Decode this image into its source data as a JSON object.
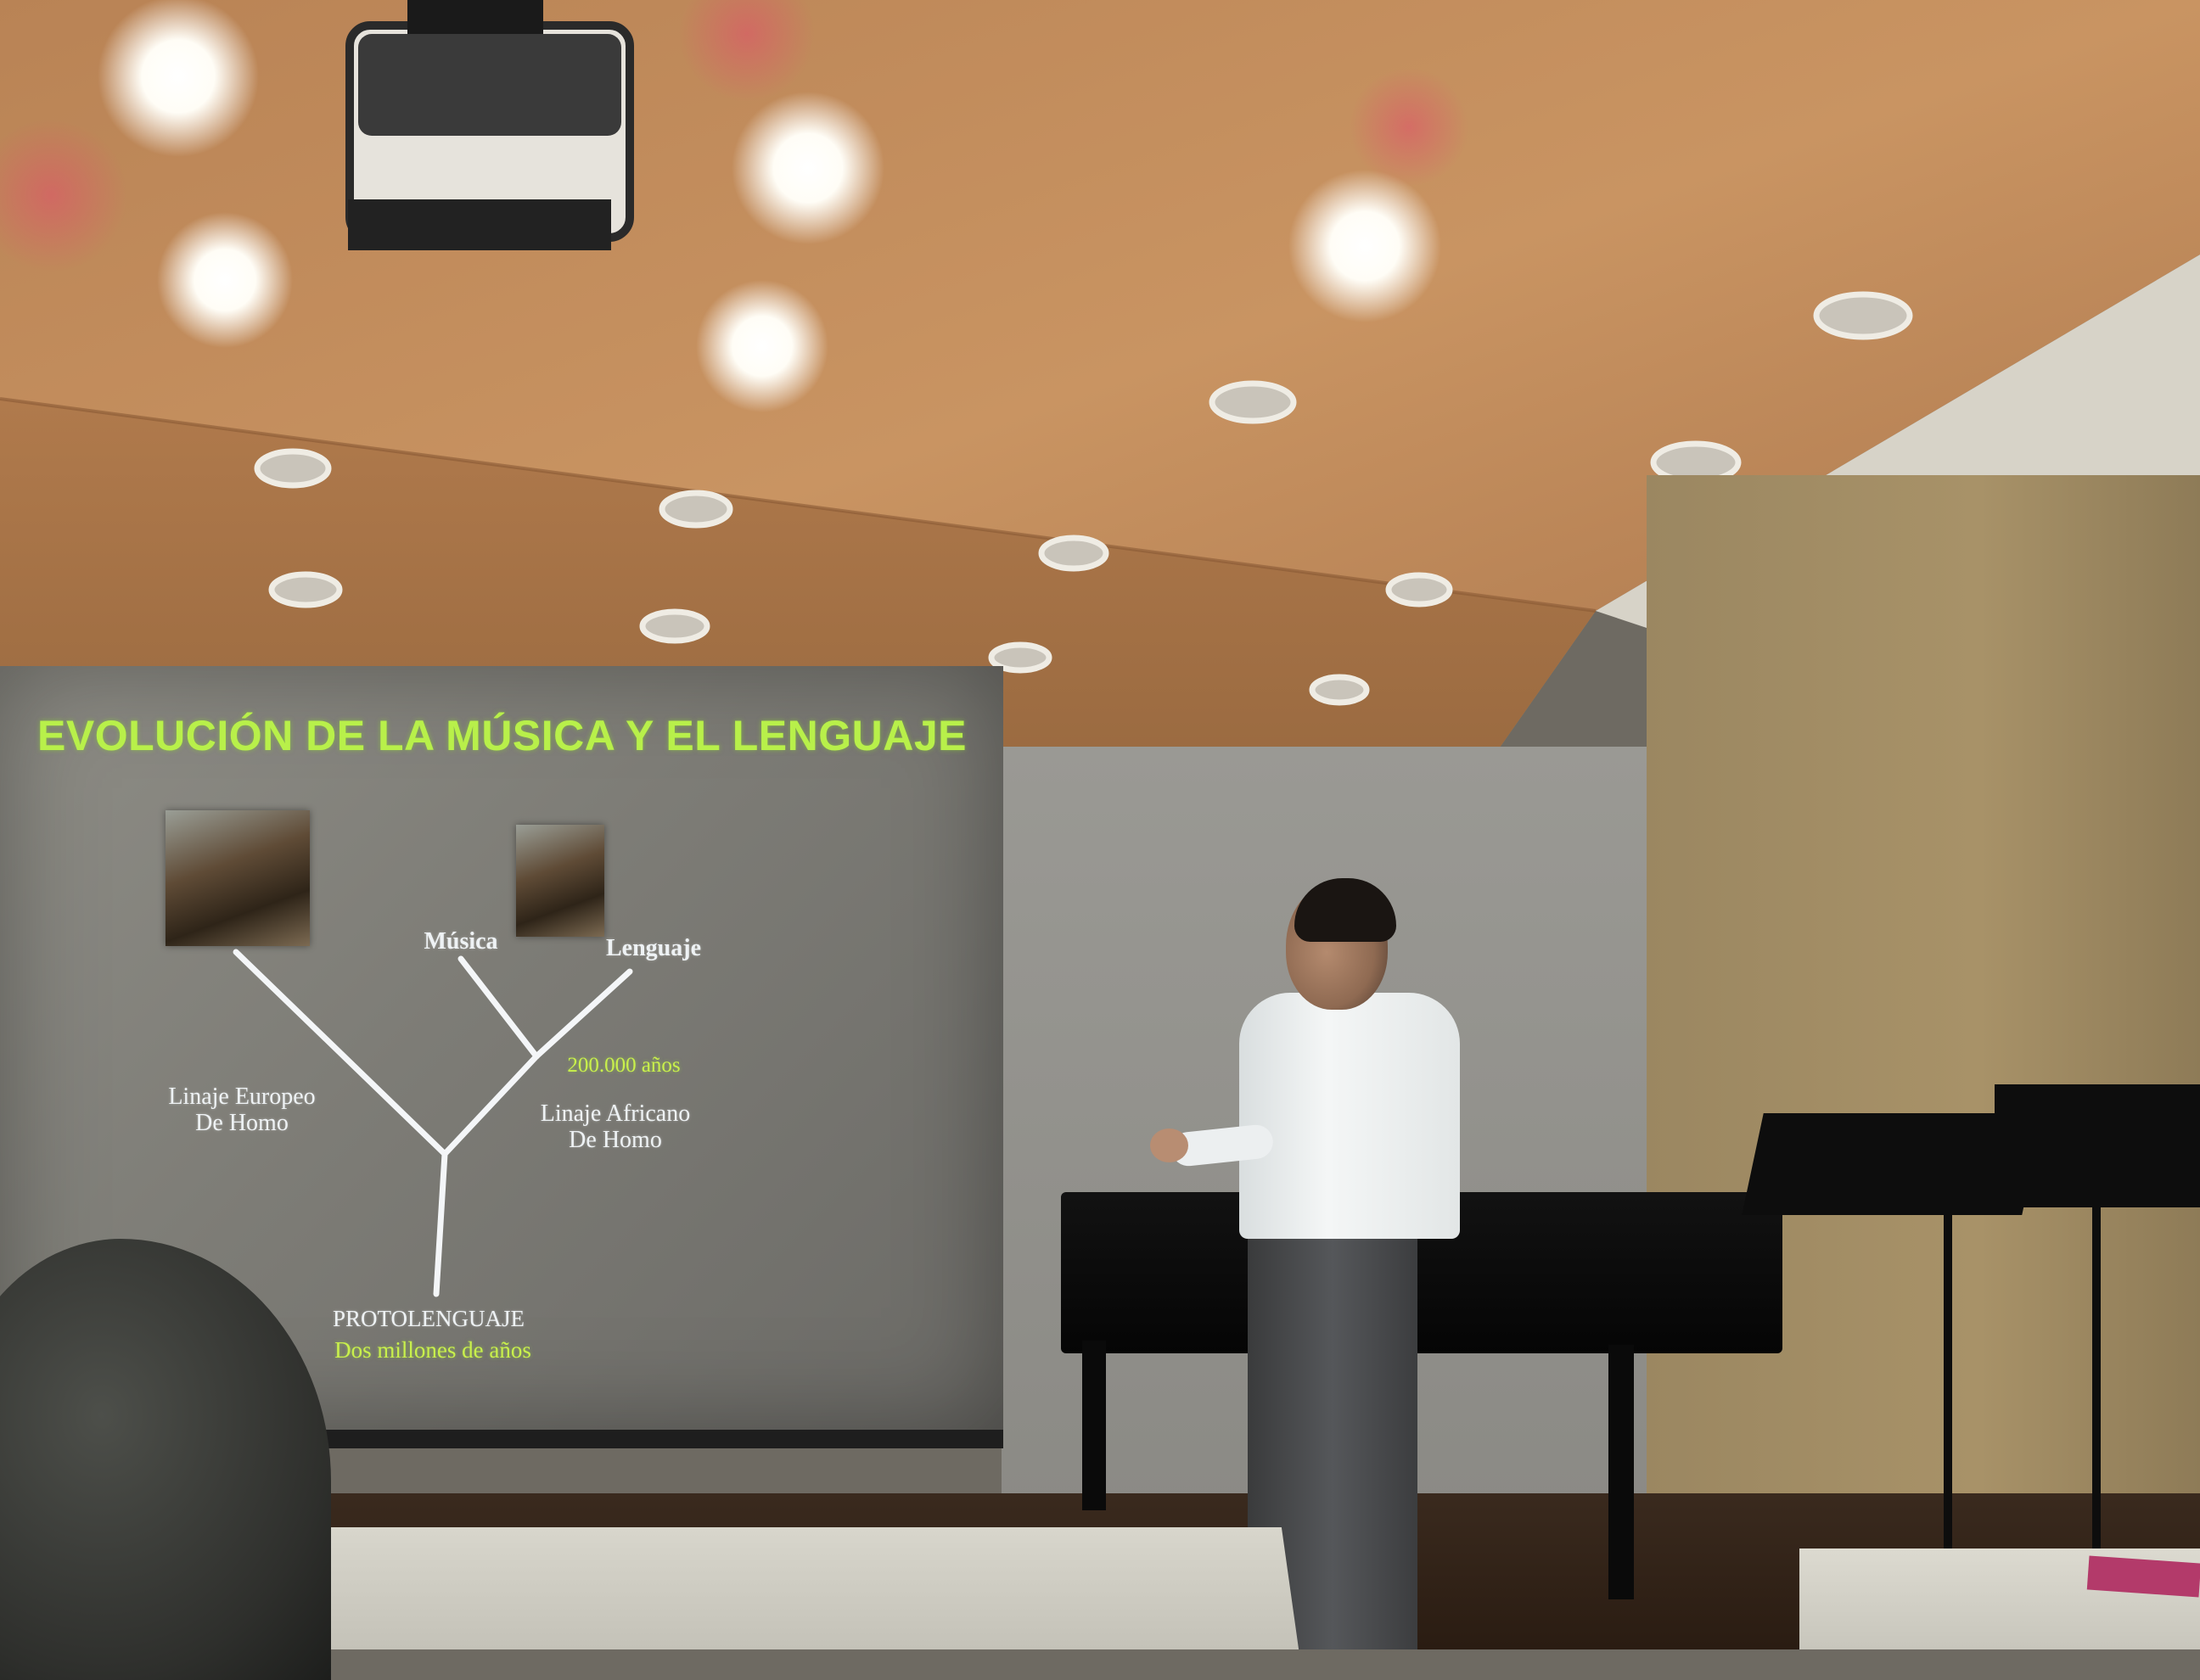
{
  "slide": {
    "title": "EVOLUCIÓN DE LA MÚSICA Y EL LENGUAJE",
    "branch_left_label": [
      "Linaje Europeo",
      "De Homo"
    ],
    "branch_right_label": [
      "Linaje Africano",
      "De Homo"
    ],
    "top_left_label": "Música",
    "top_right_label": "Lenguaje",
    "split_time_label": "200.000 años",
    "root_label": "PROTOLENGUAJE",
    "root_time_label": "Dos millones de años"
  },
  "colors": {
    "slide_title": "#b8f04a",
    "slide_text": "#eef2f4",
    "ceiling_wood": "#c08a55",
    "wall": "#8b8a85"
  }
}
